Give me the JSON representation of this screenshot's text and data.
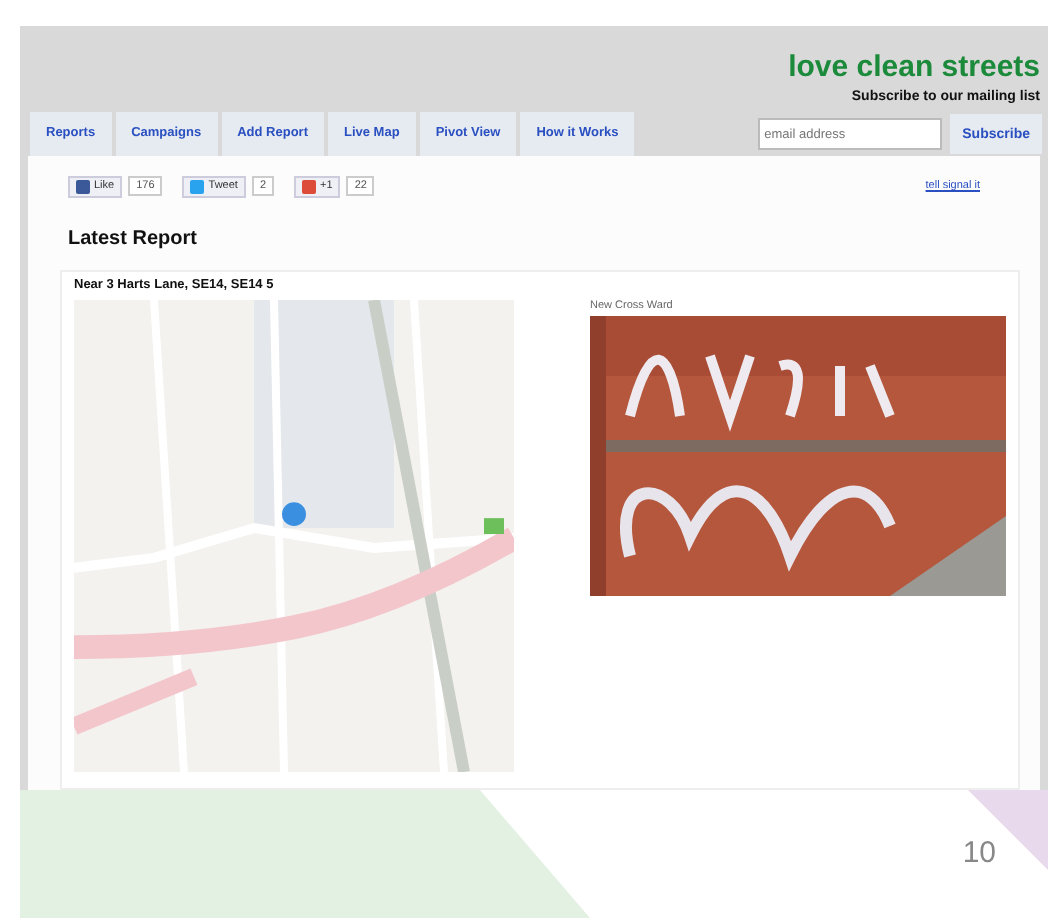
{
  "site": {
    "logo": "love clean streets",
    "mailing_label": "Subscribe to our mailing list",
    "email": {
      "placeholder": "email address"
    },
    "subscribe_button": "Subscribe"
  },
  "tabs": [
    {
      "label": "Reports"
    },
    {
      "label": "Campaigns"
    },
    {
      "label": "Add Report"
    },
    {
      "label": "Live Map"
    },
    {
      "label": "Pivot View"
    },
    {
      "label": "How it Works"
    }
  ],
  "social": [
    {
      "kind": "facebook",
      "label": "Like",
      "count": "176"
    },
    {
      "kind": "twitter",
      "label": "Tweet",
      "count": "2"
    },
    {
      "kind": "google",
      "label": "+1",
      "count": "22"
    }
  ],
  "top_link": "tell signal it",
  "heading": "Latest Report",
  "report": {
    "title": "Near 3 Harts Lane, SE14, SE14 5",
    "photo_caption": "New Cross Ward"
  },
  "slide_number": "10"
}
